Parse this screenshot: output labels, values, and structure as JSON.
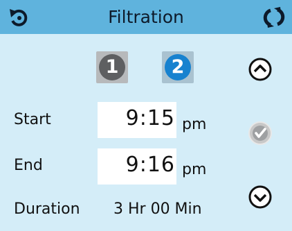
{
  "header": {
    "title": "Filtration",
    "back_icon": "back-icon",
    "refresh_icon": "refresh-icon"
  },
  "filter_tabs": [
    {
      "label": "1",
      "selected": false
    },
    {
      "label": "2",
      "selected": true
    }
  ],
  "start": {
    "label": "Start",
    "time": "9:15",
    "ampm": "pm"
  },
  "end": {
    "label": "End",
    "time": "9:16",
    "ampm": "pm"
  },
  "duration": {
    "label": "Duration",
    "value": "3 Hr 00 Min"
  },
  "controls": {
    "up_icon": "chevron-up-icon",
    "confirm_icon": "checkmark-icon",
    "down_icon": "chevron-down-icon"
  },
  "colors": {
    "header": "#5fb3dd",
    "background": "#d4edf8",
    "tab1": "#5e5f61",
    "tab2": "#1782cf"
  }
}
